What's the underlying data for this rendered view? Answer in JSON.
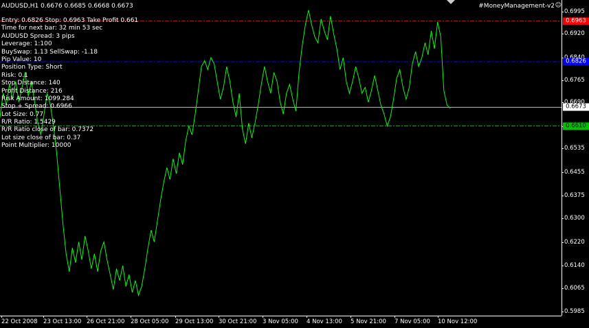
{
  "header": {
    "symbol_line": "AUDUSD,H1  0.6676 0.6685 0.6668 0.6673",
    "indicator_name": "#MoneyManagement-v2",
    "smiley": "☺"
  },
  "info_lines": [
    "Entry: 0.6826 Stop: 0.6963 Take Profit 0.661",
    "Time for next bar: 32 min 53 sec",
    "AUDUSD Spread:  3 pips",
    "Leverage:  1:100",
    "BuySwap:  1.13   SellSwap:  -1.18",
    "Pip Value: 10",
    "Position Type: Short",
    "Risk: 0.1",
    "Stop Distance: 140",
    "Profit Distance: 216",
    "Risk Amount: 1099.284",
    "Stop + Spread: 0.6966",
    "Lot Size: 0.77",
    "R/R Ratio: 1.5429",
    "R/R Ratio close of bar: 0.7372",
    "Lot size close of bar: 0.37",
    "Point Multiplier: 10000"
  ],
  "colors": {
    "background": "#000000",
    "price_line": "#00ff00",
    "stop_line": "#ff0000",
    "entry_line": "#0000ff",
    "take_profit_line": "#00c000",
    "current_line": "#c0c0c0",
    "axis": "#ffffff"
  },
  "chart_data": {
    "type": "line",
    "title": "",
    "xlabel": "",
    "ylabel": "",
    "ylim": [
      0.5972,
      0.7034
    ],
    "y_ticks": [
      "0.6995",
      "0.6920",
      "0.6840",
      "0.6765",
      "0.6690",
      "0.6610",
      "0.6535",
      "0.6455",
      "0.6375",
      "0.6300",
      "0.6220",
      "0.6140",
      "0.6065",
      "0.5985"
    ],
    "x_ticks": [
      "22 Oct 2008",
      "23 Oct 13:00",
      "26 Oct 21:00",
      "28 Oct 05:00",
      "29 Oct 13:00",
      "30 Oct 21:00",
      "3 Nov 05:00",
      "4 Nov 13:00",
      "5 Nov 21:00",
      "7 Nov 05:00",
      "10 Nov 12:00"
    ],
    "levels": [
      {
        "name": "stop",
        "label": "0.6963",
        "value": 0.6963,
        "color": "#ff0000"
      },
      {
        "name": "entry",
        "label": "0.6826",
        "value": 0.6826,
        "color": "#0000ff"
      },
      {
        "name": "current",
        "label": "0.6673",
        "value": 0.6673,
        "color": "#c0c0c0"
      },
      {
        "name": "take_profit",
        "label": "0.6610",
        "value": 0.661,
        "color": "#00c000"
      }
    ],
    "series": [
      {
        "values": [
          0.664,
          0.672,
          0.668,
          0.675,
          0.67,
          0.676,
          0.669,
          0.674,
          0.679,
          0.671,
          0.676,
          0.669,
          0.662,
          0.658,
          0.665,
          0.672,
          0.668,
          0.661,
          0.652,
          0.64,
          0.628,
          0.618,
          0.612,
          0.62,
          0.615,
          0.622,
          0.616,
          0.624,
          0.619,
          0.613,
          0.618,
          0.612,
          0.619,
          0.622,
          0.616,
          0.611,
          0.606,
          0.613,
          0.609,
          0.614,
          0.607,
          0.611,
          0.605,
          0.609,
          0.604,
          0.607,
          0.613,
          0.62,
          0.626,
          0.622,
          0.629,
          0.636,
          0.642,
          0.647,
          0.643,
          0.65,
          0.645,
          0.652,
          0.648,
          0.656,
          0.661,
          0.658,
          0.665,
          0.673,
          0.681,
          0.683,
          0.68,
          0.684,
          0.682,
          0.676,
          0.67,
          0.674,
          0.681,
          0.676,
          0.669,
          0.664,
          0.672,
          0.66,
          0.655,
          0.662,
          0.657,
          0.662,
          0.668,
          0.675,
          0.681,
          0.676,
          0.672,
          0.679,
          0.676,
          0.669,
          0.665,
          0.672,
          0.675,
          0.67,
          0.666,
          0.679,
          0.688,
          0.695,
          0.7,
          0.695,
          0.691,
          0.689,
          0.697,
          0.693,
          0.69,
          0.698,
          0.692,
          0.687,
          0.68,
          0.684,
          0.676,
          0.672,
          0.676,
          0.681,
          0.677,
          0.672,
          0.674,
          0.669,
          0.673,
          0.678,
          0.673,
          0.668,
          0.665,
          0.661,
          0.664,
          0.67,
          0.677,
          0.68,
          0.674,
          0.67,
          0.674,
          0.682,
          0.686,
          0.681,
          0.684,
          0.689,
          0.685,
          0.693,
          0.687,
          0.696,
          0.691,
          0.673,
          0.668,
          0.667
        ]
      }
    ]
  }
}
